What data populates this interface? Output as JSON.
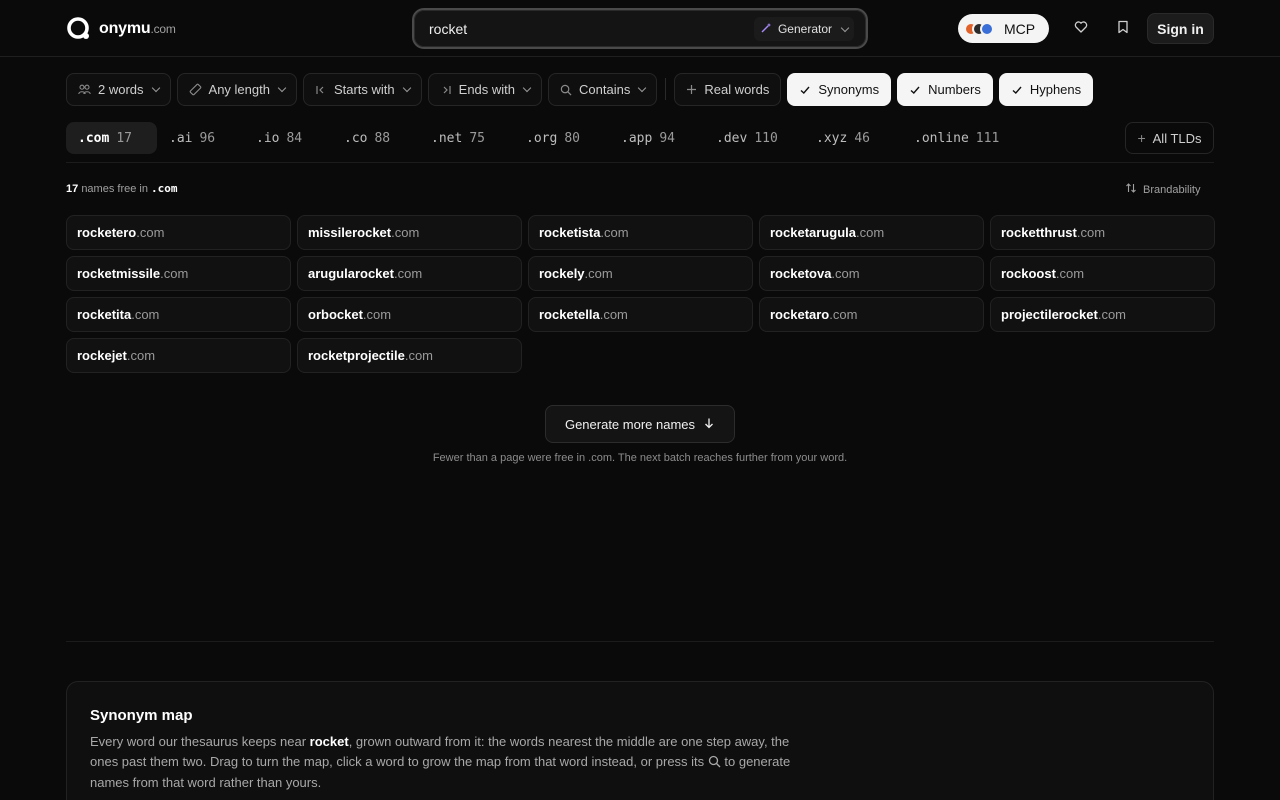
{
  "header": {
    "logo_name": "onymu",
    "logo_domain": ".com",
    "search_value": "rocket",
    "generator_label": "Generator",
    "mcp_label": "MCP",
    "mcp_colors": [
      "#e0622a",
      "#2b2b2b",
      "#3a6fd8"
    ],
    "signin_label": "Sign in",
    "icons": [
      "magic-wand-icon",
      "heart-icon",
      "bookmark-icon"
    ]
  },
  "filters": [
    {
      "label": "2 words",
      "icon": "people-icon",
      "dropdown": true,
      "active": false
    },
    {
      "label": "Any length",
      "icon": "ruler-icon",
      "dropdown": true,
      "active": false
    },
    {
      "label": "Starts with",
      "icon": "bar-left-icon",
      "dropdown": true,
      "active": false
    },
    {
      "label": "Ends with",
      "icon": "bar-right-icon",
      "dropdown": true,
      "active": false
    },
    {
      "label": "Contains",
      "icon": "search-icon",
      "dropdown": true,
      "active": false
    },
    {
      "label": "Real words",
      "icon": "plus-icon",
      "dropdown": false,
      "active": false
    },
    {
      "label": "Synonyms",
      "icon": "check-icon",
      "dropdown": false,
      "active": true
    },
    {
      "label": "Numbers",
      "icon": "check-icon",
      "dropdown": false,
      "active": true
    },
    {
      "label": "Hyphens",
      "icon": "check-icon",
      "dropdown": false,
      "active": true
    }
  ],
  "tlds": [
    {
      "name": ".com",
      "count": "17",
      "active": true
    },
    {
      "name": ".ai",
      "count": "96",
      "active": false
    },
    {
      "name": ".io",
      "count": "84",
      "active": false
    },
    {
      "name": ".co",
      "count": "88",
      "active": false
    },
    {
      "name": ".net",
      "count": "75",
      "active": false
    },
    {
      "name": ".org",
      "count": "80",
      "active": false
    },
    {
      "name": ".app",
      "count": "94",
      "active": false
    },
    {
      "name": ".dev",
      "count": "110",
      "active": false
    },
    {
      "name": ".xyz",
      "count": "46",
      "active": false
    },
    {
      "name": ".online",
      "count": "111",
      "active": false
    }
  ],
  "all_tlds_label": "All TLDs",
  "results": {
    "count": "17",
    "count_text": "names free in",
    "tld": ".com",
    "sort_label": "Brandability",
    "names": [
      "rocketero",
      "missilerocket",
      "rocketista",
      "rocketarugula",
      "rocketthrust",
      "rocketmissile",
      "arugularocket",
      "rockely",
      "rocketova",
      "rockoost",
      "rocketita",
      "orbocket",
      "rocketella",
      "rocketaro",
      "projectilerocket",
      "rockejet",
      "rocketprojectile"
    ],
    "suffix": ".com"
  },
  "more": {
    "button_label": "Generate more names",
    "note": "Fewer than a page were free in .com. The next batch reaches further from your word."
  },
  "synonym_map": {
    "title": "Synonym map",
    "desc_before": "Every word our thesaurus keeps near ",
    "desc_word": "rocket",
    "desc_after": ", grown outward from it: the words nearest the middle are one step away, the ones past them two. Drag to turn the map, click a word to grow the map from that word instead, or press its ",
    "desc_end": " to generate names from that word rather than yours."
  }
}
